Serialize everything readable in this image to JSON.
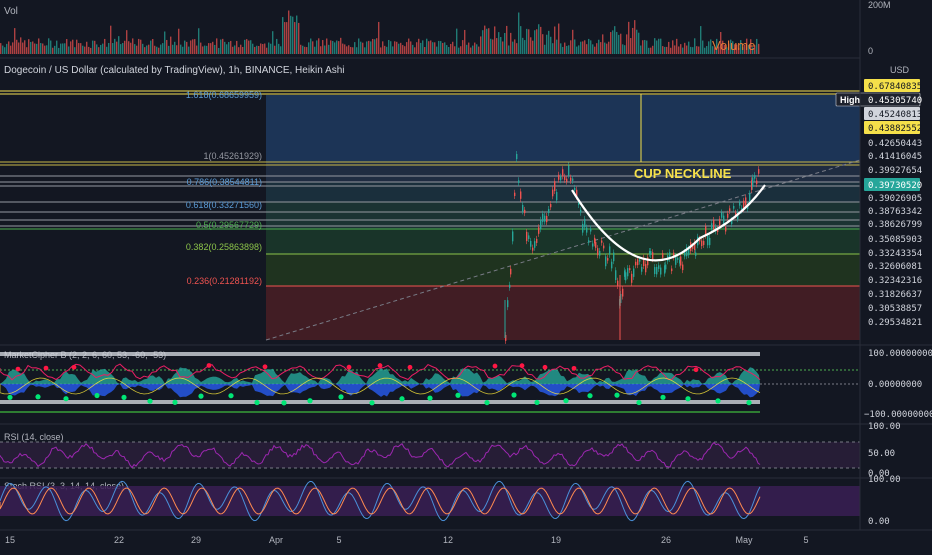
{
  "header": {
    "symbol_title": "Dogecoin / US Dollar (calculated by TradingView), 1h, BINANCE, Heikin Ashi",
    "currency": "USD"
  },
  "volume_pane": {
    "label": "Vol",
    "legend": "Volume",
    "scale": [
      "200M",
      "0"
    ]
  },
  "price_pane": {
    "axis_ticks": [
      "0.42650443",
      "0.41416045",
      "0.39927654",
      "0.39026905",
      "0.38763342",
      "0.38626799",
      "0.35085903",
      "0.33243354",
      "0.32606081",
      "0.32342316",
      "0.31826637",
      "0.30538857",
      "0.29534821"
    ],
    "price_badges": [
      {
        "text": "0.67840835",
        "style": "yellow"
      },
      {
        "text": "0.45305740",
        "style": "dark",
        "prefix": "High"
      },
      {
        "text": "0.45240813",
        "style": "light"
      },
      {
        "text": "0.43882552",
        "style": "yellow"
      },
      {
        "text": "0.39730520",
        "style": "green"
      }
    ],
    "fib_levels": [
      {
        "ratio": "1.618",
        "value": "0.68659959",
        "label": "1.618(0.68659959)",
        "color": "#5b9bd5"
      },
      {
        "ratio": "1",
        "value": "0.45261929",
        "label": "1(0.45261929)",
        "color": "#9598a1"
      },
      {
        "ratio": "0.786",
        "value": "0.38544811",
        "label": "0.786(0.38544811)",
        "color": "#5b9bd5"
      },
      {
        "ratio": "0.618",
        "value": "0.33271560",
        "label": "0.618(0.33271560)",
        "color": "#5b9bd5"
      },
      {
        "ratio": "0.5",
        "value": "0.29567729",
        "label": "0.5(0.29567729)",
        "color": "#4caf50"
      },
      {
        "ratio": "0.382",
        "value": "0.25863898",
        "label": "0.382(0.25863898)",
        "color": "#8bc34a"
      },
      {
        "ratio": "0.236",
        "value": "0.21281192",
        "label": "0.236(0.21281192)",
        "color": "#ef5350"
      }
    ],
    "annotation": "CUP NECKLINE"
  },
  "marketcipher_pane": {
    "title": "MarketCipher B (2, 2, 6, 60, 53, -60, -53)",
    "scale": [
      "100.00000000",
      "0.00000000",
      "−100.00000000"
    ]
  },
  "rsi_pane": {
    "title": "RSI (14, close)",
    "scale": [
      "100.00",
      "50.00",
      "0.00"
    ]
  },
  "stoch_pane": {
    "title": "Stoch RSI (3, 3, 14, 14, close)",
    "scale": [
      "100.00",
      "0.00"
    ]
  },
  "time_axis": {
    "labels": [
      "15",
      "22",
      "29",
      "Apr",
      "5",
      "12",
      "19",
      "26",
      "May",
      "5"
    ]
  },
  "colors": {
    "background": "#131722",
    "fib_blue": "#1e3a5f",
    "fib_green": "#1b3a2a",
    "fib_red": "#4a1f24",
    "bull": "#26a69a",
    "bear": "#ef5350",
    "rsi": "#9c27b0",
    "accent_yellow": "#f5e04a"
  },
  "chart_data": {
    "type": "candlestick",
    "title": "Dogecoin / US Dollar (calculated by TradingView), 1h, BINANCE, Heikin Ashi",
    "x": [
      "15",
      "22",
      "29",
      "Apr",
      "5",
      "12",
      "19",
      "26",
      "May",
      "5"
    ],
    "series": [
      {
        "name": "Volume",
        "type": "bar"
      },
      {
        "name": "MarketCipher B (2, 2, 6, 60, 53, -60, -53)",
        "type": "oscillator",
        "ylim": [
          -100,
          100
        ]
      },
      {
        "name": "RSI (14, close)",
        "type": "line",
        "ylim": [
          0,
          100
        ]
      },
      {
        "name": "Stoch RSI (3, 3, 14, 14, close)",
        "type": "line",
        "ylim": [
          0,
          100
        ]
      }
    ],
    "price_path_approx": [
      {
        "x": "17",
        "y": 0.296
      },
      {
        "x": "18",
        "y": 0.395
      },
      {
        "x": "19",
        "y": 0.38
      },
      {
        "x": "21",
        "y": 0.34
      },
      {
        "x": "23",
        "y": 0.33
      },
      {
        "x": "24",
        "y": 0.31
      },
      {
        "x": "25",
        "y": 0.33
      },
      {
        "x": "28",
        "y": 0.345
      },
      {
        "x": "1",
        "y": 0.372
      },
      {
        "x": "3",
        "y": 0.397
      }
    ],
    "fib_retracement": [
      1.618,
      1,
      0.786,
      0.618,
      0.5,
      0.382,
      0.236
    ],
    "annotations": [
      "CUP NECKLINE"
    ]
  }
}
